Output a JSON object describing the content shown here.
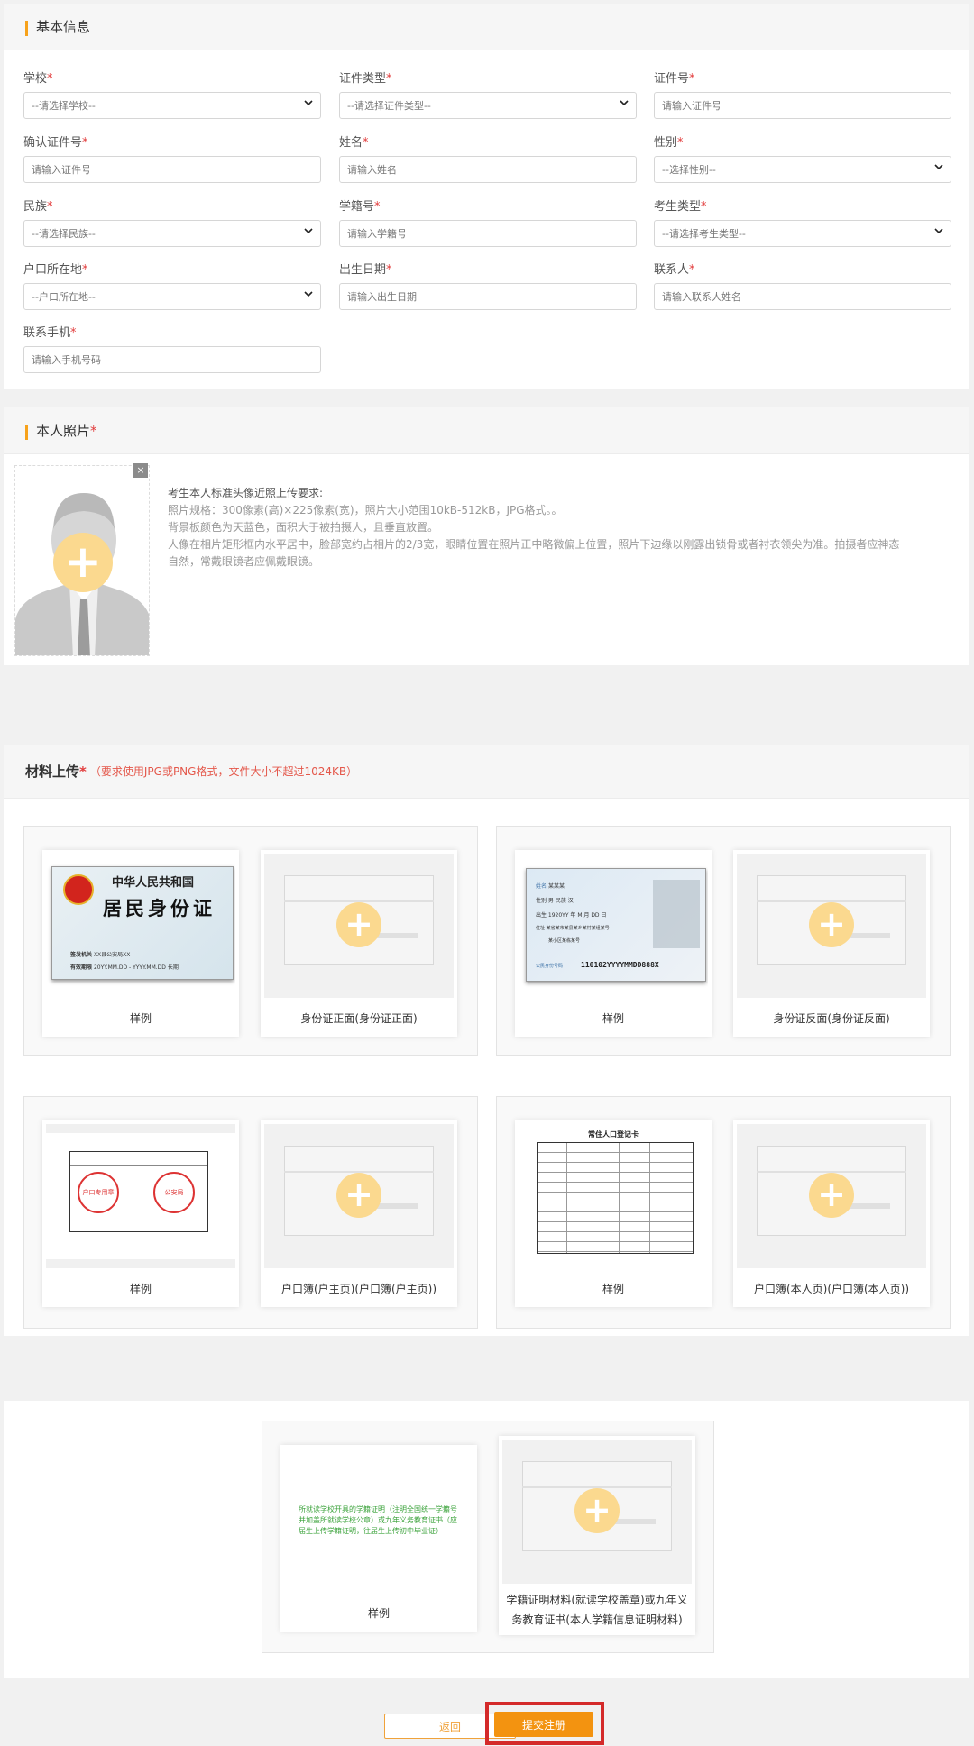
{
  "basic_info": {
    "title": "基本信息",
    "fields": [
      {
        "label": "学校",
        "value": "--请选择学校--",
        "type": "select"
      },
      {
        "label": "证件类型",
        "value": "--请选择证件类型--",
        "type": "select"
      },
      {
        "label": "证件号",
        "value": "请输入证件号",
        "type": "input"
      },
      {
        "label": "确认证件号",
        "value": "请输入证件号",
        "type": "input"
      },
      {
        "label": "姓名",
        "value": "请输入姓名",
        "type": "input"
      },
      {
        "label": "性别",
        "value": "--选择性别--",
        "type": "select"
      },
      {
        "label": "民族",
        "value": "--请选择民族--",
        "type": "select"
      },
      {
        "label": "学籍号",
        "value": "请输入学籍号",
        "type": "input"
      },
      {
        "label": "考生类型",
        "value": "--请选择考生类型--",
        "type": "select"
      },
      {
        "label": "户口所在地",
        "value": "--户口所在地--",
        "type": "select"
      },
      {
        "label": "出生日期",
        "value": "请输入出生日期",
        "type": "input"
      },
      {
        "label": "联系人",
        "value": "请输入联系人姓名",
        "type": "input"
      },
      {
        "label": "联系手机",
        "value": "请输入手机号码",
        "type": "input"
      }
    ],
    "required_mark": "*"
  },
  "photo": {
    "title": "本人照片",
    "required_mark": "*",
    "close": "×",
    "plus": "+",
    "hint_lines": [
      "考生本人标准头像近照上传要求:",
      "照片规格：300像素(高)×225像素(宽)，照片大小范围10kB-512kB，JPG格式。。",
      "背景板颜色为天蓝色，面积大于被拍摄人，且垂直放置。",
      "人像在相片矩形框内水平居中，脸部宽约占相片的2/3宽，眼睛位置在照片正中略微偏上位置，照片下边缘以刚露出锁骨或者衬衣领尖为准。拍摄者应神态",
      "自然，常戴眼镜者应佩戴眼镜。"
    ]
  },
  "materials": {
    "title": "材料上传",
    "required_mark": "*",
    "note": "（要求使用JPG或PNG格式，文件大小不超过1024KB）",
    "sample_label": "样例",
    "plus": "+",
    "groups": [
      {
        "upload_label": "身份证正面(身份证正面)"
      },
      {
        "upload_label": "身份证反面(身份证反面)"
      },
      {
        "upload_label": "户口簿(户主页)(户口簿(户主页))"
      },
      {
        "upload_label": "户口簿(本人页)(户口簿(本人页))"
      },
      {
        "upload_label": "学籍证明材料(就读学校盖章)或九年义务教育证书(本人学籍信息证明材料)"
      }
    ],
    "id_front_sample": {
      "country": "中华人民共和国",
      "title": "居民身份证",
      "authority_label": "签发机关",
      "authority_value": "XX县公安局XX",
      "validity_label": "有效期限",
      "validity_value": "20YY.MM.DD - YYYY.MM.DD 长期"
    },
    "id_back_sample": {
      "name_label": "姓名",
      "name_value": "某某某",
      "line2": "性别 男 民族 汉",
      "line3": "出生 1920YY 年 M 月 DD 日",
      "line4": "住址 某省某市某县某乡某村某组某号",
      "line5": "某小区某栋某号",
      "number_label": "公民身份号码",
      "number_value": "110102YYYYMMDD888X"
    },
    "household_sample": {
      "stamp1": "户口专用章",
      "stamp2": "公安局"
    },
    "person_page_sample": {
      "title": "常住人口登记卡"
    },
    "school_sample_text": "所就读学校开具的学籍证明（注明全国统一学籍号并加盖所就读学校公章）或九年义务教育证书（应届生上传学籍证明，往届生上传初中毕业证）"
  },
  "actions": {
    "back": "返回",
    "submit": "提交注册"
  },
  "colors": {
    "accent": "#f7a21b",
    "required": "#e23d3d",
    "submit": "#f39310",
    "highlight": "#d42a2a",
    "sample_text": "#3aa23a"
  }
}
